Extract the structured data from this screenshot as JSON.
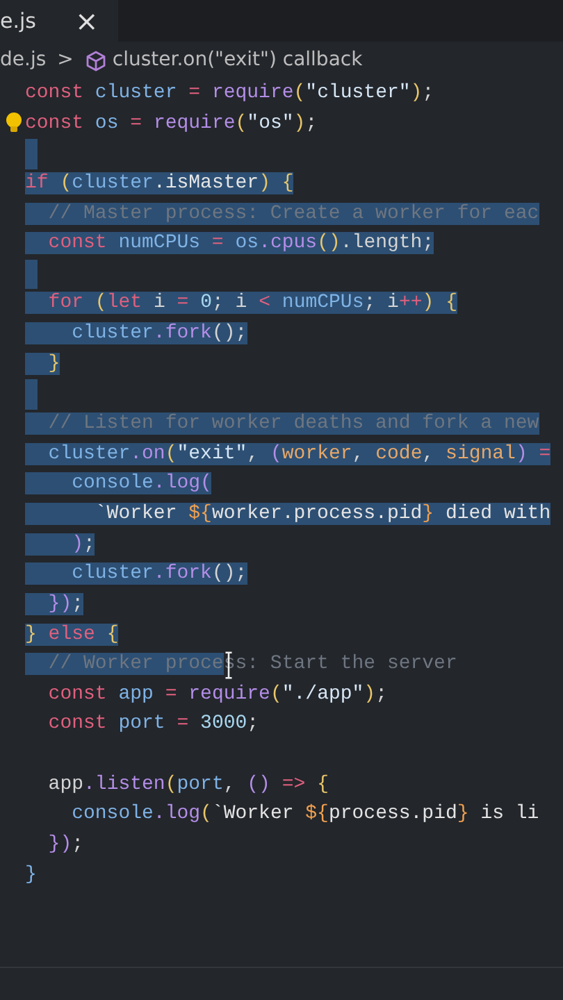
{
  "tab": {
    "label": "e.js",
    "close": "×",
    "selected": true
  },
  "breadcrumb": {
    "file": "de.js",
    "separator": ">",
    "symbol": "cluster.on(\"exit\") callback"
  },
  "lines": [
    {
      "segments": [
        {
          "selected": false,
          "tokens": [
            {
              "text": "const",
              "kind": "keyword"
            },
            {
              "text": " cluster",
              "kind": "variable"
            },
            {
              "text": " =",
              "kind": "operator"
            },
            {
              "text": " require",
              "kind": "function"
            },
            {
              "text": "(",
              "kind": "bracket"
            },
            {
              "text": "\"cluster\"",
              "kind": "string"
            },
            {
              "text": ")",
              "kind": "bracket"
            },
            {
              "text": ";",
              "kind": "plain"
            }
          ]
        }
      ]
    },
    {
      "segments": [
        {
          "selected": false,
          "tokens": [
            {
              "text": "const",
              "kind": "keyword"
            },
            {
              "text": " os",
              "kind": "variable"
            },
            {
              "text": " =",
              "kind": "operator"
            },
            {
              "text": " require",
              "kind": "function"
            },
            {
              "text": "(",
              "kind": "bracket"
            },
            {
              "text": "\"os\"",
              "kind": "string"
            },
            {
              "text": ")",
              "kind": "bracket"
            },
            {
              "text": ";",
              "kind": "plain"
            }
          ]
        }
      ]
    },
    {
      "selected": true
    },
    {
      "segments": [
        {
          "selected": true,
          "tokens": [
            {
              "text": "if",
              "kind": "keyword"
            },
            {
              "text": " (",
              "kind": "bracket"
            },
            {
              "text": "cluster",
              "kind": "variable"
            },
            {
              "text": ".isMaster",
              "kind": "property"
            },
            {
              "text": ")",
              "kind": "bracket"
            },
            {
              "text": " {",
              "kind": "bracket"
            }
          ]
        }
      ]
    },
    {
      "segments": [
        {
          "selected": true,
          "tokens": [
            {
              "text": "  // Master process: Create a worker for eac",
              "kind": "comment"
            }
          ]
        }
      ]
    },
    {
      "segments": [
        {
          "selected": true,
          "tokens": [
            {
              "text": "  const",
              "kind": "keyword"
            },
            {
              "text": " numCPUs",
              "kind": "variable"
            },
            {
              "text": " =",
              "kind": "operator"
            },
            {
              "text": " os",
              "kind": "variable"
            },
            {
              "text": ".cpus",
              "kind": "function"
            },
            {
              "text": "()",
              "kind": "bracket"
            },
            {
              "text": ".length;",
              "kind": "plain"
            }
          ]
        }
      ]
    },
    {
      "selected": true
    },
    {
      "segments": [
        {
          "selected": true,
          "tokens": [
            {
              "text": "  for",
              "kind": "keyword"
            },
            {
              "text": " (",
              "kind": "bracket"
            },
            {
              "text": "let",
              "kind": "keyword"
            },
            {
              "text": " i",
              "kind": "plain"
            },
            {
              "text": " =",
              "kind": "operator"
            },
            {
              "text": " 0",
              "kind": "number"
            },
            {
              "text": "; i",
              "kind": "plain"
            },
            {
              "text": " <",
              "kind": "operator"
            },
            {
              "text": " numCPUs",
              "kind": "variable"
            },
            {
              "text": "; i",
              "kind": "plain"
            },
            {
              "text": "++",
              "kind": "operator"
            },
            {
              "text": ")",
              "kind": "bracket"
            },
            {
              "text": " {",
              "kind": "bracket"
            }
          ]
        }
      ]
    },
    {
      "segments": [
        {
          "selected": true,
          "tokens": [
            {
              "text": "    cluster",
              "kind": "variable"
            },
            {
              "text": ".fork",
              "kind": "function"
            },
            {
              "text": "();",
              "kind": "plain"
            }
          ]
        }
      ]
    },
    {
      "segments": [
        {
          "selected": true,
          "tokens": [
            {
              "text": "  }",
              "kind": "bracket"
            }
          ]
        }
      ]
    },
    {
      "selected": true
    },
    {
      "segments": [
        {
          "selected": true,
          "tokens": [
            {
              "text": "  // Listen for worker deaths and fork a new",
              "kind": "comment"
            }
          ]
        }
      ]
    },
    {
      "segments": [
        {
          "selected": true,
          "tokens": [
            {
              "text": "  cluster",
              "kind": "variable"
            },
            {
              "text": ".on",
              "kind": "function"
            },
            {
              "text": "(",
              "kind": "bracket"
            },
            {
              "text": "\"exit\"",
              "kind": "string"
            },
            {
              "text": ",",
              "kind": "plain"
            },
            {
              "text": " (",
              "kind": "bracket2"
            },
            {
              "text": "worker",
              "kind": "parameter"
            },
            {
              "text": ",",
              "kind": "plain"
            },
            {
              "text": " code",
              "kind": "parameter"
            },
            {
              "text": ",",
              "kind": "plain"
            },
            {
              "text": " signal",
              "kind": "parameter"
            },
            {
              "text": ")",
              "kind": "bracket2"
            },
            {
              "text": " =",
              "kind": "operator"
            }
          ]
        }
      ]
    },
    {
      "segments": [
        {
          "selected": true,
          "tokens": [
            {
              "text": "    console",
              "kind": "variable"
            },
            {
              "text": ".log",
              "kind": "function"
            },
            {
              "text": "(",
              "kind": "bracket2"
            }
          ]
        }
      ]
    },
    {
      "segments": [
        {
          "selected": true,
          "tokens": [
            {
              "text": "      `Worker",
              "kind": "template"
            },
            {
              "text": " ${",
              "kind": "interpolation"
            },
            {
              "text": "worker.process.pid",
              "kind": "template"
            },
            {
              "text": "}",
              "kind": "interpolation"
            },
            {
              "text": " died with",
              "kind": "template"
            }
          ]
        }
      ]
    },
    {
      "segments": [
        {
          "selected": true,
          "tokens": [
            {
              "text": "    )",
              "kind": "bracket2"
            },
            {
              "text": ";",
              "kind": "plain"
            }
          ]
        }
      ]
    },
    {
      "segments": [
        {
          "selected": true,
          "tokens": [
            {
              "text": "    cluster",
              "kind": "variable"
            },
            {
              "text": ".fork",
              "kind": "function"
            },
            {
              "text": "();",
              "kind": "plain"
            }
          ]
        }
      ]
    },
    {
      "segments": [
        {
          "selected": true,
          "tokens": [
            {
              "text": "  })",
              "kind": "bracket2"
            },
            {
              "text": ";",
              "kind": "plain"
            }
          ]
        }
      ]
    },
    {
      "segments": [
        {
          "selected": true,
          "tokens": [
            {
              "text": "}",
              "kind": "bracket"
            },
            {
              "text": " else",
              "kind": "keyword"
            },
            {
              "text": " {",
              "kind": "bracket"
            }
          ]
        }
      ]
    },
    {
      "segments": [
        {
          "selected": true,
          "tokens": [
            {
              "text": "  // Worker proce",
              "kind": "comment"
            }
          ]
        },
        {
          "selected": false,
          "tokens": [
            {
              "text": "ss: Start the server",
              "kind": "comment"
            }
          ]
        }
      ]
    },
    {
      "segments": [
        {
          "selected": false,
          "tokens": [
            {
              "text": "  const",
              "kind": "keyword"
            },
            {
              "text": " app",
              "kind": "variable"
            },
            {
              "text": " =",
              "kind": "operator"
            },
            {
              "text": " require",
              "kind": "function"
            },
            {
              "text": "(",
              "kind": "bracket"
            },
            {
              "text": "\"./app\"",
              "kind": "string"
            },
            {
              "text": ")",
              "kind": "bracket"
            },
            {
              "text": ";",
              "kind": "plain"
            }
          ]
        }
      ]
    },
    {
      "segments": [
        {
          "selected": false,
          "tokens": [
            {
              "text": "  const",
              "kind": "keyword"
            },
            {
              "text": " port",
              "kind": "variable"
            },
            {
              "text": " =",
              "kind": "operator"
            },
            {
              "text": " 3000",
              "kind": "number"
            },
            {
              "text": ";",
              "kind": "plain"
            }
          ]
        }
      ]
    },
    {
      "selected": false
    },
    {
      "segments": [
        {
          "selected": false,
          "tokens": [
            {
              "text": "  app",
              "kind": "plain"
            },
            {
              "text": ".listen",
              "kind": "function"
            },
            {
              "text": "(",
              "kind": "bracket"
            },
            {
              "text": "port",
              "kind": "variable"
            },
            {
              "text": ",",
              "kind": "plain"
            },
            {
              "text": " ()",
              "kind": "bracket2"
            },
            {
              "text": " =>",
              "kind": "operator"
            },
            {
              "text": " {",
              "kind": "bracket"
            }
          ]
        }
      ]
    },
    {
      "segments": [
        {
          "selected": false,
          "tokens": [
            {
              "text": "    console",
              "kind": "variable"
            },
            {
              "text": ".log",
              "kind": "function"
            },
            {
              "text": "(",
              "kind": "bracket"
            },
            {
              "text": "`Worker",
              "kind": "template"
            },
            {
              "text": " ${",
              "kind": "interpolation"
            },
            {
              "text": "process.pid",
              "kind": "template"
            },
            {
              "text": "}",
              "kind": "interpolation"
            },
            {
              "text": " is li",
              "kind": "template"
            }
          ]
        }
      ]
    },
    {
      "segments": [
        {
          "selected": false,
          "tokens": [
            {
              "text": "  })",
              "kind": "bracket2"
            },
            {
              "text": ";",
              "kind": "plain"
            }
          ]
        }
      ]
    },
    {
      "segments": [
        {
          "selected": false,
          "tokens": [
            {
              "text": "}",
              "kind": "bracket3"
            }
          ]
        }
      ]
    }
  ]
}
